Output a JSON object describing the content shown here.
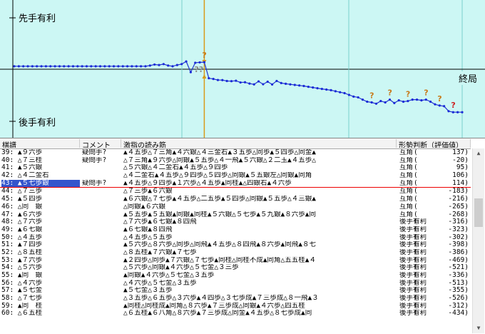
{
  "graph": {
    "label_top": "先手有利",
    "label_bottom": "後手有利",
    "label_end": "終局",
    "current_move": 43,
    "total_moves": 100,
    "question_marks": [
      {
        "move": 43,
        "kind": "?"
      },
      {
        "move": 43,
        "kind": "??"
      },
      {
        "move": 80,
        "kind": "?"
      },
      {
        "move": 84,
        "kind": "?"
      },
      {
        "move": 88,
        "kind": "?"
      },
      {
        "move": 92,
        "kind": "?"
      },
      {
        "move": 95,
        "kind": "?"
      },
      {
        "move": 98,
        "kind": "?"
      }
    ]
  },
  "table": {
    "headers": [
      "棋譜",
      "コメント",
      "激指の読み筋",
      "形勢判断（評価値）"
    ],
    "rows": [
      {
        "move": "39: ▲９六歩",
        "comment": "疑問手?",
        "line": "▲４五歩△７三角▲４六銀△４三金右▲３五歩△同歩▲５四歩△同金▲",
        "judge": "互角",
        "value": "137)"
      },
      {
        "move": "40: △７三桂",
        "comment": "疑問手?",
        "line": "△７三角▲９六歩△同銀▲５五歩△４一飛▲５六銀△２二玉▲４五歩△",
        "judge": "互角",
        "value": "-20)"
      },
      {
        "move": "41: ▲５六銀",
        "comment": "",
        "line": "△５六銀△４二金右▲４五歩△９四歩",
        "judge": "互角",
        "value": "95)"
      },
      {
        "move": "42: △４二金右",
        "comment": "",
        "line": "△４二金右▲４五歩△９四歩△５四歩△同銀▲５五銀左△同銀▲同角",
        "judge": "互角",
        "value": "106)"
      },
      {
        "move": "43: ▲５七歩銀",
        "comment": "疑問手?",
        "line": "▲４五歩△９四歩▲１六歩△４五歩▲同桂▲△四銀右▲４六歩",
        "judge": "互角",
        "value": "114)",
        "selected": true
      },
      {
        "move": "44: △７三歩",
        "comment": "",
        "line": "△７三歩▲６六銀",
        "judge": "互角",
        "value": "-183)"
      },
      {
        "move": "45: ▲５四歩",
        "comment": "",
        "line": "▲６六銀△７七歩▲４五歩△二五歩▲５四歩△同銀▲５五歩△４三銀▲",
        "judge": "互角",
        "value": "-216)"
      },
      {
        "move": "46: △同　銀",
        "comment": "",
        "line": "△同銀▲６六銀",
        "judge": "互角",
        "value": "-265)"
      },
      {
        "move": "47: ▲６六歩",
        "comment": "",
        "line": "▲５五歩▲５五銀▲同銀▲同桂▲５六銀△５七歩▲５九銀▲８六歩▲同",
        "judge": "互角",
        "value": "-268)"
      },
      {
        "move": "48: △７六歩",
        "comment": "",
        "line": "△７六歩▲６七銀▲８四飛",
        "judge": "後手有利",
        "value": "-316)"
      },
      {
        "move": "49: ▲６七銀",
        "comment": "",
        "line": "▲６七銀▲８四飛",
        "judge": "後手有利",
        "value": "-323)"
      },
      {
        "move": "50: △４五歩",
        "comment": "",
        "line": "△４五歩△５五歩",
        "judge": "後手有利",
        "value": "-302)"
      },
      {
        "move": "51: ▲７四歩",
        "comment": "",
        "line": "▲５六歩△８六歩△同歩△同飛▲４五歩△８四飛▲８六歩▲同飛▲８七",
        "judge": "後手有利",
        "value": "-398)"
      },
      {
        "move": "52: △８五桂",
        "comment": "",
        "line": "△８五桂▲７六銀▲７七歩",
        "judge": "後手有利",
        "value": "-386)"
      },
      {
        "move": "53: ▲７六歩",
        "comment": "",
        "line": "▲２四歩△同歩▲７六銀△７七歩▲同桂△同桂不成▲同角△五五桂▲４",
        "judge": "後手有利",
        "value": "-469)"
      },
      {
        "move": "54: △５六歩",
        "comment": "",
        "line": "△５六歩△同銀▲４六歩△５七金△３三歩",
        "judge": "後手有利",
        "value": "-521)"
      },
      {
        "move": "55: ▲同　銀",
        "comment": "",
        "line": "▲同銀▲４六歩△５七金△３五歩",
        "judge": "後手有利",
        "value": "-336)"
      },
      {
        "move": "56: △４六歩",
        "comment": "",
        "line": "△４六歩△５七金△３五歩",
        "judge": "後手有利",
        "value": "-513)"
      },
      {
        "move": "57: ▲５七金",
        "comment": "",
        "line": "▲５七金△３五歩",
        "judge": "後手有利",
        "value": "-355)"
      },
      {
        "move": "58: △７七歩",
        "comment": "",
        "line": "△３五歩△６五歩△３六歩▲４四歩△３七歩成▲７三歩成△８一飛▲３",
        "judge": "後手有利",
        "value": "-526)"
      },
      {
        "move": "59: ▲同　桂",
        "comment": "",
        "line": "▲同桂△同桂成▲同角△８六歩▲７三歩成△同銀▲４六歩△四五桂",
        "judge": "後手有利",
        "value": "-312)"
      },
      {
        "move": "60: △６五桂",
        "comment": "",
        "line": "△６五桂▲６八角△８六歩▲７三歩成△同金▲４五歩△８七歩成▲同",
        "judge": "後手有利",
        "value": "-434)"
      }
    ]
  },
  "chart_data": {
    "type": "line",
    "x": [
      1,
      2,
      3,
      4,
      5,
      6,
      7,
      8,
      9,
      10,
      11,
      12,
      13,
      14,
      15,
      16,
      17,
      18,
      19,
      20,
      21,
      22,
      23,
      24,
      25,
      26,
      27,
      28,
      29,
      30,
      31,
      32,
      33,
      34,
      35,
      36,
      37,
      38,
      39,
      40,
      41,
      42,
      43,
      44,
      45,
      46,
      47,
      48,
      49,
      50,
      51,
      52,
      53,
      54,
      55,
      56,
      57,
      58,
      59,
      60,
      61,
      62,
      63,
      64,
      65,
      66,
      67,
      68,
      69,
      70,
      71,
      72,
      73,
      74,
      75,
      76,
      77,
      78,
      79,
      80,
      81,
      82,
      83,
      84,
      85,
      86,
      87,
      88,
      89,
      90,
      91,
      92,
      93,
      94,
      95,
      96,
      97,
      98,
      99,
      100
    ],
    "values": [
      20,
      20,
      20,
      20,
      20,
      20,
      20,
      20,
      20,
      20,
      20,
      20,
      20,
      20,
      20,
      20,
      20,
      20,
      20,
      20,
      20,
      20,
      20,
      20,
      20,
      20,
      20,
      20,
      20,
      20,
      30,
      50,
      40,
      60,
      30,
      20,
      40,
      60,
      137,
      -20,
      95,
      106,
      114,
      -183,
      -216,
      -265,
      -268,
      -316,
      -323,
      -302,
      -398,
      -386,
      -469,
      -521,
      -336,
      -513,
      -355,
      -526,
      -312,
      -434,
      -480,
      -520,
      -560,
      -600,
      -640,
      -700,
      -760,
      -820,
      -880,
      -940,
      -1000,
      -1100,
      -1200,
      -1300,
      -1500,
      -1700,
      -1800,
      -2100,
      -2400,
      -2500,
      -2700,
      -2300,
      -2500,
      -2100,
      -2600,
      -2200,
      -2400,
      -2300,
      -2100,
      -2100,
      -2200,
      -2100,
      -2400,
      -2800,
      -3000,
      -3100,
      -4000,
      -4200,
      -4200,
      -4200
    ],
    "ylim": [
      -6000,
      6000
    ]
  }
}
